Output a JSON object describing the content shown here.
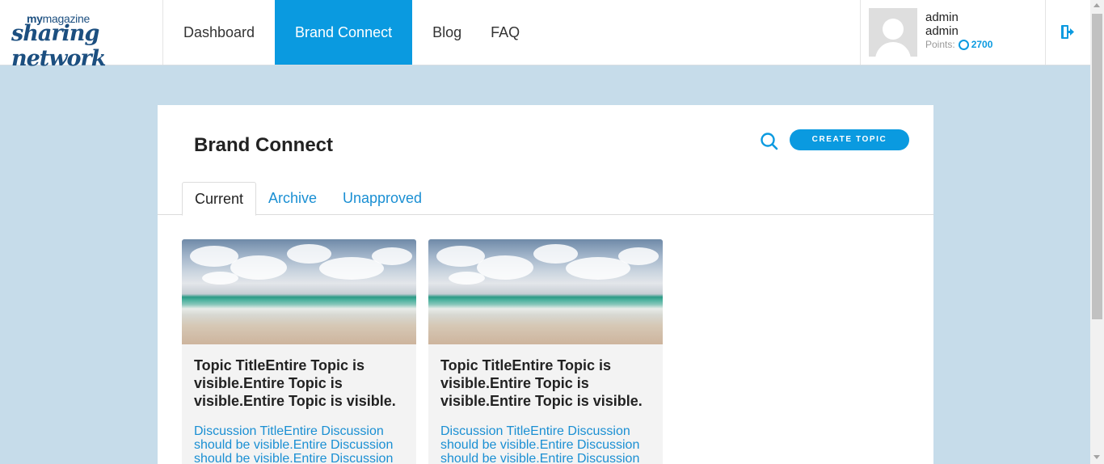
{
  "brand": {
    "logo_small_bold": "my",
    "logo_small_rest": "magazine",
    "logo_big": "sharing network"
  },
  "nav": {
    "items": [
      {
        "label": "Dashboard"
      },
      {
        "label": "Brand Connect",
        "active": true
      },
      {
        "label": "Blog"
      },
      {
        "label": "FAQ"
      }
    ]
  },
  "user": {
    "first_name": "admin",
    "last_name": "admin",
    "points_label": "Points:",
    "points_value": "2700"
  },
  "page": {
    "title": "Brand Connect",
    "create_button": "CREATE TOPIC"
  },
  "tabs": [
    {
      "label": "Current",
      "active": true
    },
    {
      "label": "Archive"
    },
    {
      "label": "Unapproved"
    }
  ],
  "topics": [
    {
      "title": "Topic TitleEntire Topic is visible.Entire Topic is visible.Entire Topic is visible.",
      "discussion": "Discussion TitleEntire Discussion should be visible.Entire Discussion should be visible.Entire Discussion"
    },
    {
      "title": "Topic TitleEntire Topic is visible.Entire Topic is visible.Entire Topic is visible.",
      "discussion": "Discussion TitleEntire Discussion should be visible.Entire Discussion should be visible.Entire Discussion"
    }
  ],
  "colors": {
    "accent": "#0a9ae0",
    "link": "#1a8fd3",
    "background": "#c6dcea",
    "logo": "#1c4f80"
  }
}
